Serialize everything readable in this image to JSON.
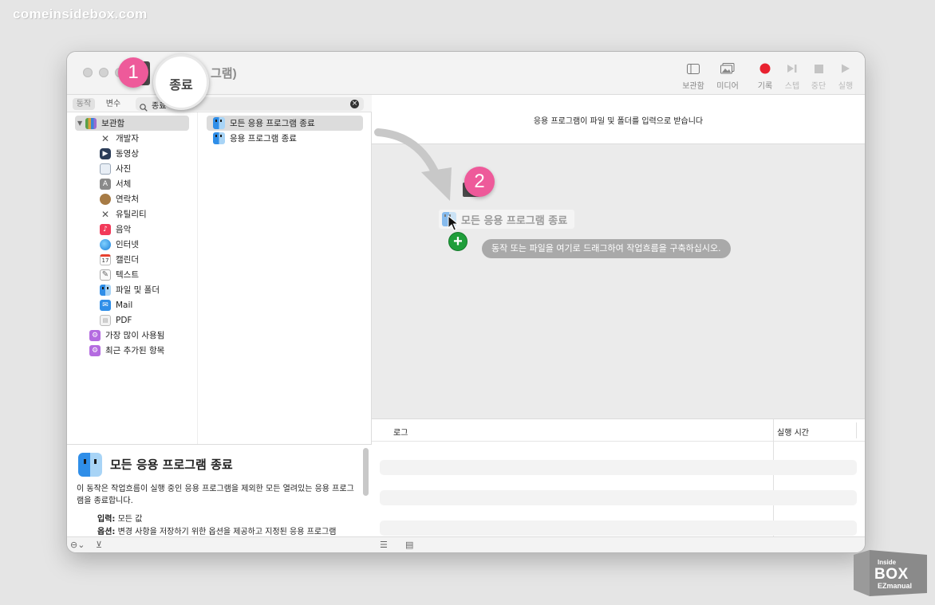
{
  "watermark": {
    "site": "comeinsidebox.com",
    "brand_top": "Inside",
    "brand_main": "BOX",
    "brand_sub": "EZmanual"
  },
  "window": {
    "title_partial": "그램)"
  },
  "toolbar": {
    "library_label": "보관함",
    "media_label": "미디어",
    "record_label": "기록",
    "step_label": "스텝",
    "stop_label": "중단",
    "run_label": "실행",
    "record_color": "#e8212f"
  },
  "library": {
    "tab_actions": "동작",
    "tab_variables": "변수",
    "search_value": "종료",
    "categories": [
      {
        "label": "보관함",
        "icon": "library-folder-icon"
      },
      {
        "label": "개발자",
        "icon": "developer-tools-icon"
      },
      {
        "label": "동영상",
        "icon": "movie-icon"
      },
      {
        "label": "사진",
        "icon": "photos-icon"
      },
      {
        "label": "서체",
        "icon": "fonts-icon"
      },
      {
        "label": "연락처",
        "icon": "contacts-icon"
      },
      {
        "label": "유틸리티",
        "icon": "utilities-icon"
      },
      {
        "label": "음악",
        "icon": "music-icon"
      },
      {
        "label": "인터넷",
        "icon": "internet-globe-icon"
      },
      {
        "label": "캘린더",
        "icon": "calendar-icon"
      },
      {
        "label": "텍스트",
        "icon": "text-icon"
      },
      {
        "label": "파일 및 폴더",
        "icon": "finder-icon"
      },
      {
        "label": "Mail",
        "icon": "mail-icon"
      },
      {
        "label": "PDF",
        "icon": "pdf-icon"
      },
      {
        "label": "가장 많이 사용됨",
        "icon": "smart-folder-icon"
      },
      {
        "label": "최근 추가된 항목",
        "icon": "smart-folder-icon"
      }
    ],
    "calendar_day": "17",
    "actions": [
      {
        "label": "모든 응용 프로그램 종료"
      },
      {
        "label": "응용 프로그램 종료"
      }
    ]
  },
  "description": {
    "title": "모든 응용 프로그램 종료",
    "body": "이 동작은 작업흐름이 실행 중인 응용 프로그램을 제외한 모든 열려있는 응용 프로그램을 종료합니다.",
    "input_label": "입력:",
    "input_value": "모든 값",
    "options_label": "옵션:",
    "options_value": "변경 사항을 저장하기 위한 옵션을 제공하고 지정된 응용 프로그램"
  },
  "workflow": {
    "header_text": "응용 프로그램이 파일 및 폴더를 입력으로 받습니다",
    "dragged_action": "모든 응용 프로그램 종료",
    "drop_hint": "동작 또는 파일을 여기로 드래그하여 작업흐름을 구축하십시오."
  },
  "log": {
    "col_log": "로그",
    "col_runtime": "실행 시간"
  },
  "annotations": {
    "step1": "1",
    "step2": "2",
    "callout": "종료",
    "badge_color": "#ee5a9a"
  }
}
